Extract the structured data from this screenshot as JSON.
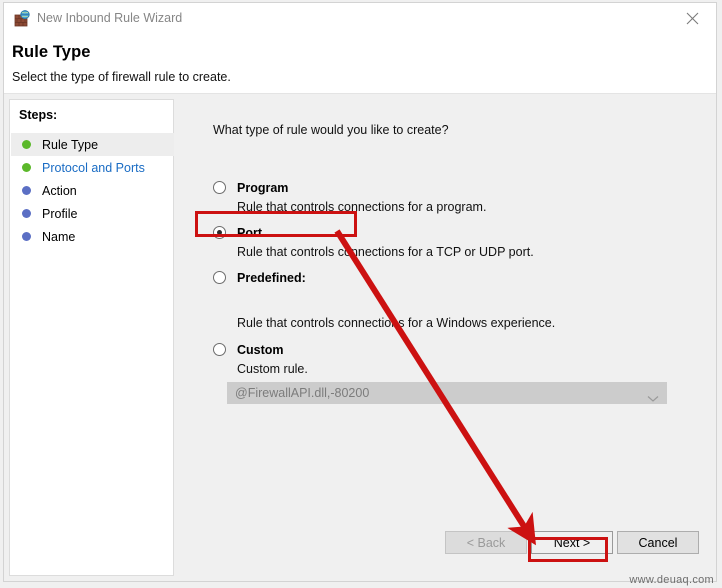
{
  "window": {
    "title": "New Inbound Rule Wizard",
    "icon": "firewall-globe-icon",
    "close_label": "✕"
  },
  "header": {
    "title": "Rule Type",
    "subtitle": "Select the type of firewall rule to create."
  },
  "sidebar": {
    "heading": "Steps:",
    "items": [
      {
        "label": "Rule Type",
        "bullet_color": "#5bb82a",
        "state": "active",
        "is_link": false
      },
      {
        "label": "Protocol and Ports",
        "bullet_color": "#5bb82a",
        "state": "available",
        "is_link": true
      },
      {
        "label": "Action",
        "bullet_color": "#5b6fc4",
        "state": "pending",
        "is_link": false
      },
      {
        "label": "Profile",
        "bullet_color": "#5b6fc4",
        "state": "pending",
        "is_link": false
      },
      {
        "label": "Name",
        "bullet_color": "#5b6fc4",
        "state": "pending",
        "is_link": false
      }
    ]
  },
  "main": {
    "question": "What type of rule would you like to create?",
    "options": [
      {
        "label": "Program",
        "description": "Rule that controls connections for a program.",
        "selected": false
      },
      {
        "label": "Port",
        "description": "Rule that controls connections for a TCP or UDP port.",
        "selected": true
      },
      {
        "label": "Predefined:",
        "description": "Rule that controls connections for a Windows experience.",
        "selected": false
      },
      {
        "label": "Custom",
        "description": "Custom rule.",
        "selected": false
      }
    ],
    "predefined_combo": {
      "value": "@FirewallAPI.dll,-80200",
      "enabled": false,
      "chevron": "chevron-down-icon"
    }
  },
  "footer": {
    "back_label": "< Back",
    "back_enabled": false,
    "next_label": "Next >",
    "cancel_label": "Cancel"
  },
  "annotations": {
    "highlight_color": "#cc1111",
    "boxes": [
      "port-option",
      "next-button"
    ],
    "arrow": {
      "from": "port-option",
      "to": "next-button"
    }
  },
  "watermark": "www.deuaq.com"
}
